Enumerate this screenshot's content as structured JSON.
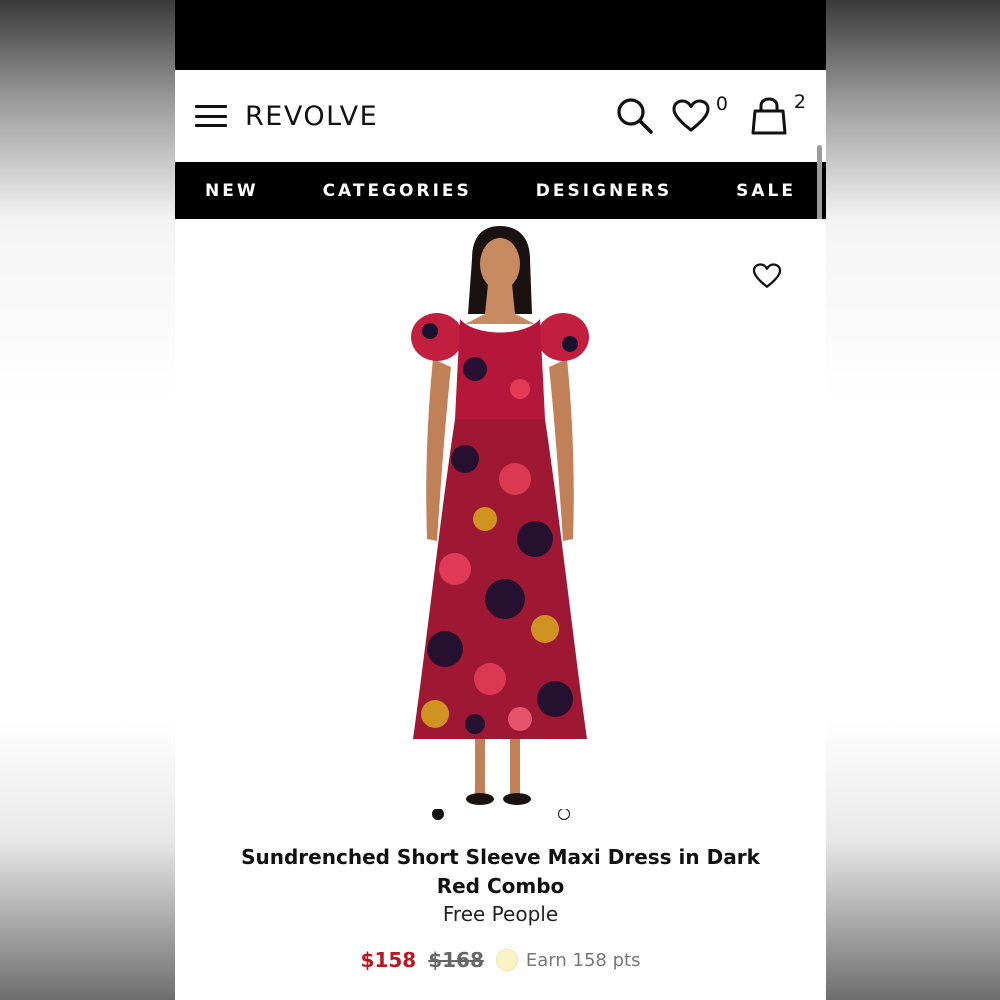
{
  "header": {
    "logo": "REVOLVE",
    "wishlist_count": "0",
    "bag_count": "2"
  },
  "nav": {
    "items": [
      "NEW",
      "CATEGORIES",
      "DESIGNERS",
      "SALE"
    ]
  },
  "product": {
    "title": "Sundrenched Short Sleeve Maxi Dress in Dark Red Combo",
    "brand": "Free People",
    "price": "$158",
    "original_price": "$168",
    "points": "Earn 158 pts",
    "image_count": 2,
    "active_image": 1
  },
  "colors": {
    "sale_red": "#c0141d",
    "black": "#000000"
  },
  "icons": [
    "menu-icon",
    "search-icon",
    "heart-icon",
    "shopping-bag-icon"
  ]
}
